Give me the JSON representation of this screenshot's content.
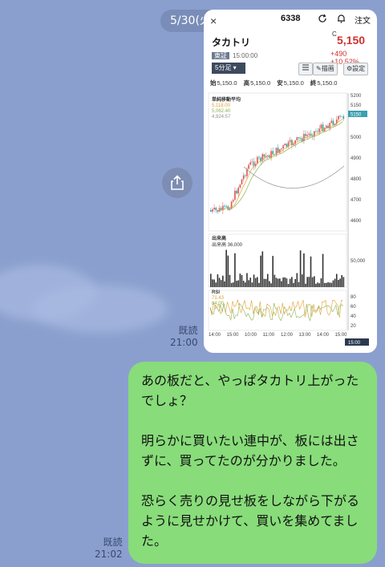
{
  "chat": {
    "date_pill": "5/30(火)",
    "image_message": {
      "read_label": "既読",
      "time": "21:00"
    },
    "text_message": {
      "read_label": "既読",
      "time": "21:02",
      "paragraphs": [
        "あの板だと、やっぱタカトリ上がったでしょ？",
        "明らかに買いたい連中が、板には出さずに、買ってたのが分かりました。",
        "恐らく売りの見せ板をしながら下がるように見せかけて、買いを集めてました。"
      ]
    },
    "icons": {
      "share": "share-icon"
    }
  },
  "screenshot": {
    "close": "×",
    "code": "6338",
    "order_label": "注文",
    "stock_name": "タカトリ",
    "current_mark": "C",
    "price": "5,150",
    "change": "+490  +10.52%",
    "market_tag": "東証",
    "market_time": "15:00:00",
    "interval": "5分足",
    "tools": {
      "draw": "描画",
      "settings": "設定"
    },
    "ohlc": [
      {
        "k": "始",
        "v": "5,150.0"
      },
      {
        "k": "高",
        "v": "5,150.0"
      },
      {
        "k": "安",
        "v": "5,150.0"
      },
      {
        "k": "終",
        "v": "5,150.0"
      }
    ],
    "ma_title": "単純移動平均",
    "ma_values": [
      "5,118.00",
      "5,062.40",
      "4,924.57"
    ],
    "volume_title": "出来高",
    "volume_value": "出来高  36,000",
    "rsi_title": "RSI",
    "rsi_values": [
      "71.43",
      "84.00"
    ],
    "price_axis": [
      "5200",
      "5150",
      "5100",
      "5000",
      "4900",
      "4800",
      "4700",
      "4600"
    ],
    "volume_axis": "50,000",
    "rsi_axis": [
      "80",
      "60",
      "40",
      "20"
    ],
    "time_axis": [
      "14:00",
      "15:00",
      "10:00",
      "11:00",
      "12:00",
      "13:00",
      "14:00",
      "15:00"
    ],
    "time_tag": "15:00",
    "colors": {
      "up": "#e05555",
      "down": "#2ea0a0",
      "ma1": "#e0a030",
      "ma2": "#8fb050",
      "ma3": "#909090"
    }
  }
}
